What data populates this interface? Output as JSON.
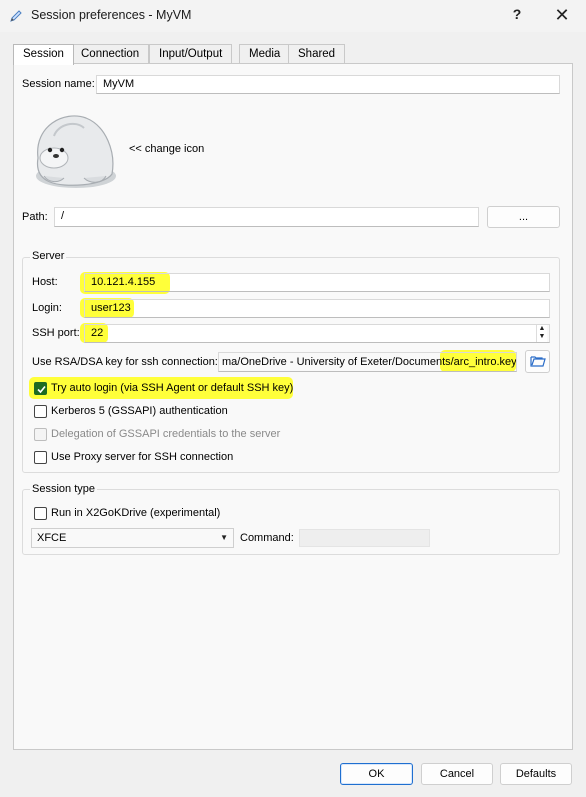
{
  "window": {
    "title": "Session preferences - MyVM",
    "help_glyph": "?",
    "close_glyph": "✕"
  },
  "tabs": [
    {
      "label": "Session"
    },
    {
      "label": "Connection"
    },
    {
      "label": "Input/Output"
    },
    {
      "label": "Media"
    },
    {
      "label": "Shared folders"
    }
  ],
  "session": {
    "name_label": "Session name:",
    "name_value": "MyVM",
    "change_icon_label": "<< change icon",
    "path_label": "Path:",
    "path_value": "/",
    "browse_label": "..."
  },
  "server": {
    "title": "Server",
    "host_label": "Host:",
    "host_value": "10.121.4.155",
    "login_label": "Login:",
    "login_value": "user123",
    "ssh_port_label": "SSH port:",
    "ssh_port_value": "22",
    "rsa_label": "Use RSA/DSA key for ssh connection:",
    "rsa_value": "ma/OneDrive - University of Exeter/Documents/arc_intro.key",
    "auto_login_label": "Try auto login (via SSH Agent or default SSH key)",
    "auto_login_checked": true,
    "kerberos_label": "Kerberos 5 (GSSAPI) authentication",
    "kerberos_checked": false,
    "delegation_label": "Delegation of GSSAPI credentials to the server",
    "delegation_checked": false,
    "proxy_label": "Use Proxy server for SSH connection",
    "proxy_checked": false
  },
  "session_type": {
    "title": "Session type",
    "x2go_label": "Run in X2GoKDrive (experimental)",
    "x2go_checked": false,
    "type_value": "XFCE",
    "command_label": "Command:",
    "command_value": ""
  },
  "footer": {
    "ok_label": "OK",
    "cancel_label": "Cancel",
    "defaults_label": "Defaults"
  },
  "colors": {
    "highlight": "#ffff3a",
    "checked_green": "#1e6b22",
    "primary_border": "#1f6fd0"
  }
}
